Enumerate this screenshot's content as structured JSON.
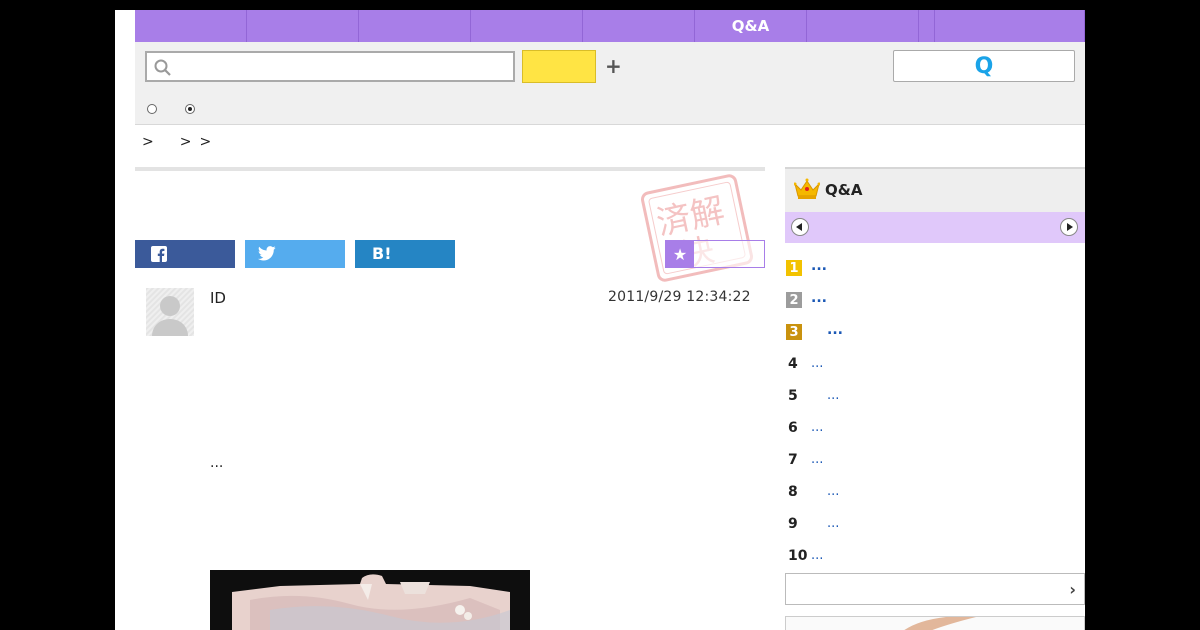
{
  "nav": {
    "items": [
      {
        "label": "",
        "width": 112
      },
      {
        "label": "",
        "width": 112
      },
      {
        "label": "",
        "width": 112
      },
      {
        "label": "",
        "width": 112
      },
      {
        "label": "",
        "width": 112
      },
      {
        "label": "Q&A",
        "width": 112
      },
      {
        "label": "",
        "width": 112
      },
      {
        "label": "",
        "width": 16
      },
      {
        "label": "",
        "width": 150
      }
    ]
  },
  "search": {
    "query": "",
    "placeholder": "",
    "submit_label": "",
    "plus_label": "+",
    "ask_label": "Q",
    "scope_options": [
      {
        "label": "",
        "checked": false
      },
      {
        "label": "",
        "checked": true
      }
    ]
  },
  "breadcrumb": [
    ">",
    ">",
    ">"
  ],
  "share": {
    "facebook_icon": "facebook-icon",
    "twitter_icon": "twitter-icon",
    "hatena_label": "B!",
    "favorite_label": "",
    "star_glyph": "★"
  },
  "stamp": {
    "text": "済解決",
    "note": "resolved stamp"
  },
  "question": {
    "user_id": "ID",
    "date": "2011/9/29  12:34:22",
    "text": "..."
  },
  "ranking": {
    "title": "Q&A",
    "items": [
      {
        "rank": "1",
        "title": "...",
        "color": "#f2c200"
      },
      {
        "rank": "2",
        "title": "...",
        "color": "#9c9c9c"
      },
      {
        "rank": "3",
        "title": "...",
        "color": "#c9920e",
        "indent": true
      },
      {
        "rank": "4",
        "title": "..."
      },
      {
        "rank": "5",
        "title": "...",
        "indent": true
      },
      {
        "rank": "6",
        "title": "..."
      },
      {
        "rank": "7",
        "title": "..."
      },
      {
        "rank": "8",
        "title": "...",
        "indent": true
      },
      {
        "rank": "9",
        "title": "...",
        "indent": true
      },
      {
        "rank": "10",
        "title": "..."
      }
    ],
    "more_label": "",
    "more_glyph": "›"
  },
  "colors": {
    "nav": "#a87ee8",
    "facebook": "#3b5a9a",
    "twitter": "#55acee",
    "hatena": "#2585c4",
    "search_button": "#ffe444",
    "link": "#1a57b5"
  }
}
